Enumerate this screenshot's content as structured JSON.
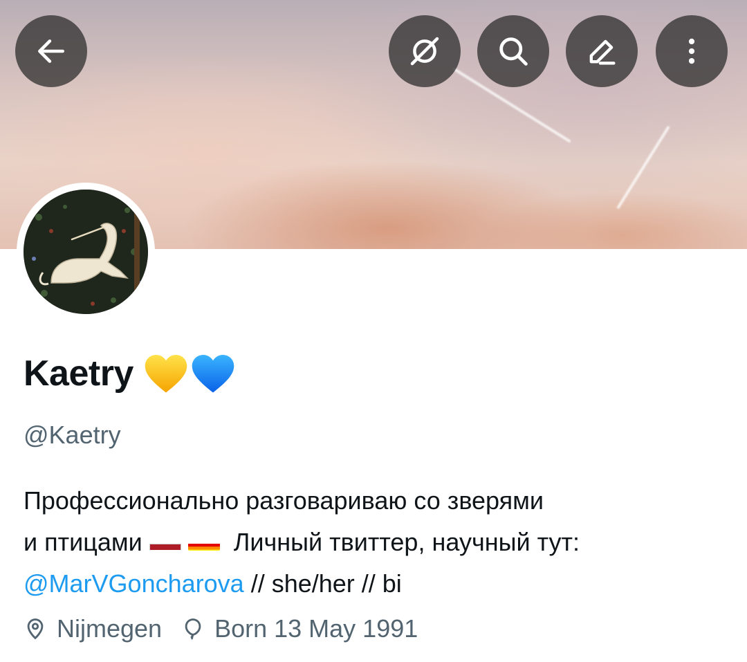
{
  "profile": {
    "display_name": "Kaetry",
    "handle": "@Kaetry",
    "bio": {
      "line1": "Профессионально разговариваю со зверями",
      "line2_prefix": "и птицами",
      "line2_suffix": "Личный твиттер, научный тут:",
      "mention": "@MarVGoncharova",
      "line3_suffix": " // she/her // bi"
    },
    "location": "Nijmegen",
    "birthday": "Born 13 May 1991"
  },
  "icons": {
    "back": "arrow-left-icon",
    "no_preview": "hide-icon",
    "search": "search-icon",
    "edit": "edit-icon",
    "more": "more-vertical-icon",
    "location": "location-pin-icon",
    "birthday": "balloon-icon"
  },
  "colors": {
    "accent": "#1d9bf0",
    "secondary_text": "#536471",
    "primary_text": "#0f1419",
    "overlay_button": "#282828"
  }
}
